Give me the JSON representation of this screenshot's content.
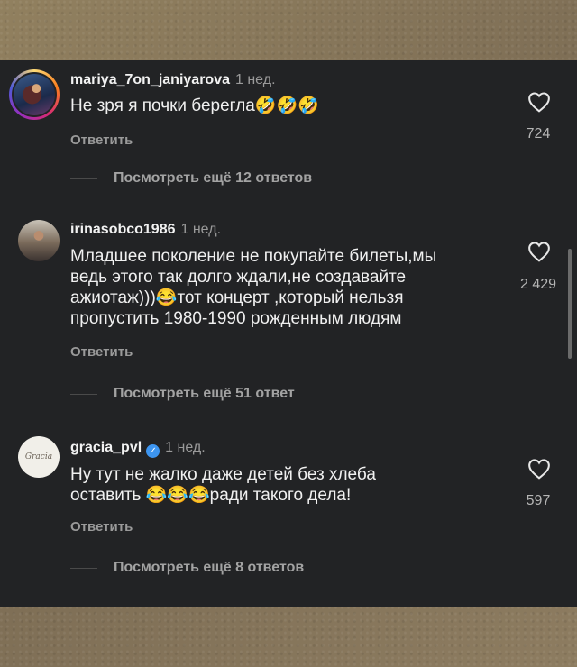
{
  "comments": [
    {
      "username": "mariya_7on_janiyarova",
      "time": "1 нед.",
      "text": "Не зря я почки берегла🤣🤣🤣",
      "reply_label": "Ответить",
      "likes": "724",
      "more_replies": "Посмотреть ещё 12 ответов",
      "verified": false
    },
    {
      "username": "irinasobco1986",
      "time": "1 нед.",
      "text": "Младшее поколение не покупайте билеты,мы\nведь этого так долго ждали,не создавайте\nажиотаж)))😂тот концерт ,который нельзя\nпропустить 1980-1990 рожденным людям",
      "reply_label": "Ответить",
      "likes": "2 429",
      "more_replies": "Посмотреть ещё 51 ответ",
      "verified": false
    },
    {
      "username": "gracia_pvl",
      "time": "1 нед.",
      "text": "Ну тут не жалко даже детей без хлеба\nоставить 😂😂😂ради такого дела!",
      "reply_label": "Ответить",
      "likes": "597",
      "more_replies": "Посмотреть ещё 8 ответов",
      "verified": true
    }
  ],
  "icons": {
    "like": "heart-outline-icon",
    "verified": "verified-badge-icon"
  },
  "colors": {
    "background": "#222325",
    "verified": "#3d95f0",
    "frame": "#8a7a62"
  }
}
